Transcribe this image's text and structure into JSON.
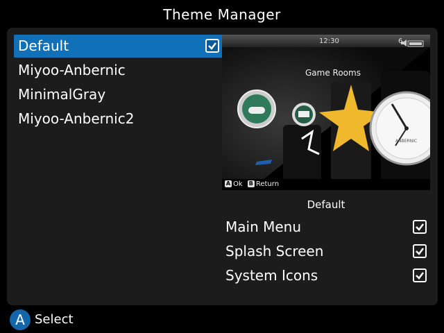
{
  "header": {
    "title": "Theme Manager"
  },
  "themes": [
    {
      "label": "Default",
      "checked": true
    },
    {
      "label": "Miyoo-Anbernic"
    },
    {
      "label": "MinimalGray"
    },
    {
      "label": "Miyoo-Anbernic2"
    }
  ],
  "preview": {
    "time": "12:30",
    "battery_level": "6",
    "section_title": "Game Rooms",
    "footer_ok_key": "A",
    "footer_ok": "Ok",
    "footer_return_key": "B",
    "footer_return": "Return",
    "clock_brand": "ANBERNIC"
  },
  "selected_theme_name": "Default",
  "components": [
    {
      "label": "Main Menu",
      "checked": true
    },
    {
      "label": "Splash Screen",
      "checked": true
    },
    {
      "label": "System Icons",
      "checked": true
    }
  ],
  "bottom_bar": {
    "button": "A",
    "label": "Select"
  },
  "colors": {
    "accent": "#1070b8",
    "panel": "#1c1c1c",
    "background": "#000000"
  }
}
